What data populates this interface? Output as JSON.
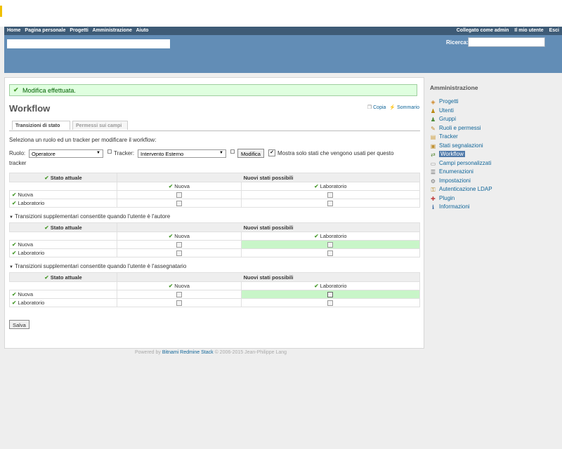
{
  "topmenu": {
    "left": [
      "Home",
      "Pagina personale",
      "Progetti",
      "Amministrazione",
      "Aiuto"
    ],
    "logged_in_as": "Collegato come",
    "user": "admin",
    "my_account": "Il mio utente",
    "logout": "Esci"
  },
  "header": {
    "search_label": "Ricerca:",
    "search_value": ""
  },
  "flash": {
    "notice": "Modifica effettuata."
  },
  "page": {
    "title": "Workflow",
    "copy_link": "Copia",
    "summary_link": "Sommario"
  },
  "tabs": [
    {
      "label": "Transizioni di stato",
      "active": true
    },
    {
      "label": "Permessi sui campi",
      "active": false
    }
  ],
  "instructions": "Seleziona un ruolo ed un tracker per modificare il workflow:",
  "filter": {
    "role_label": "Ruolo:",
    "role_value": "Operatore",
    "tracker_label": "Tracker:",
    "tracker_value": "Intervento Esterno",
    "submit_label": "Modifica",
    "used_statuses_label": "Mostra solo stati che vengono usati per questo",
    "used_statuses_label_cont": "tracker",
    "used_statuses_checked": true
  },
  "workflow": {
    "current_status_header": "Stato attuale",
    "new_statuses_header": "Nuovi stati possibili",
    "columns": [
      "Nuova",
      "Laboratorio"
    ],
    "sections": [
      {
        "title": "",
        "rows": [
          {
            "status": "Nuova",
            "cells": [
              false,
              false
            ],
            "highlight": [
              false,
              false
            ]
          },
          {
            "status": "Laboratorio",
            "cells": [
              false,
              false
            ],
            "highlight": [
              false,
              false
            ]
          }
        ]
      },
      {
        "title": "Transizioni supplementari consentite quando l'utente è l'autore",
        "rows": [
          {
            "status": "Nuova",
            "cells": [
              false,
              false
            ],
            "highlight": [
              false,
              true
            ]
          },
          {
            "status": "Laboratorio",
            "cells": [
              false,
              false
            ],
            "highlight": [
              false,
              false
            ]
          }
        ]
      },
      {
        "title": "Transizioni supplementari consentite quando l'utente è l'assegnatario",
        "rows": [
          {
            "status": "Nuova",
            "cells": [
              false,
              false
            ],
            "highlight": [
              false,
              true
            ]
          },
          {
            "status": "Laboratorio",
            "cells": [
              false,
              false
            ],
            "highlight": [
              false,
              false
            ]
          }
        ]
      }
    ]
  },
  "save_label": "Salva",
  "footer": {
    "prefix": "Powered by",
    "link": "Bitnami Redmine Stack",
    "suffix": "© 2006-2015 Jean-Philippe Lang"
  },
  "sidebar": {
    "title": "Amministrazione",
    "items": [
      {
        "label": "Progetti",
        "icon": "projects-icon",
        "glyph": "◈",
        "color": "#d08a2a"
      },
      {
        "label": "Utenti",
        "icon": "users-icon",
        "glyph": "♟",
        "color": "#b8860b"
      },
      {
        "label": "Gruppi",
        "icon": "groups-icon",
        "glyph": "♟",
        "color": "#4a8a3a"
      },
      {
        "label": "Ruoli e permessi",
        "icon": "roles-icon",
        "glyph": "✎",
        "color": "#c08a2a"
      },
      {
        "label": "Tracker",
        "icon": "tracker-icon",
        "glyph": "▤",
        "color": "#d0a040"
      },
      {
        "label": "Stati segnalazioni",
        "icon": "issue-statuses-icon",
        "glyph": "▣",
        "color": "#c09030"
      },
      {
        "label": "Workflow",
        "icon": "workflow-icon",
        "glyph": "⇄",
        "color": "#5a8a3a",
        "selected": true
      },
      {
        "label": "Campi personalizzati",
        "icon": "custom-fields-icon",
        "glyph": "▭",
        "color": "#888888"
      },
      {
        "label": "Enumerazioni",
        "icon": "enumerations-icon",
        "glyph": "☰",
        "color": "#555555"
      },
      {
        "label": "Impostazioni",
        "icon": "settings-icon",
        "glyph": "⚙",
        "color": "#777777"
      },
      {
        "label": "Autenticazione LDAP",
        "icon": "ldap-icon",
        "glyph": "⚿",
        "color": "#b88a2a"
      },
      {
        "label": "Plugin",
        "icon": "plugins-icon",
        "glyph": "✚",
        "color": "#c04040"
      },
      {
        "label": "Informazioni",
        "icon": "info-icon",
        "glyph": "ℹ",
        "color": "#3a6aa0"
      }
    ]
  }
}
